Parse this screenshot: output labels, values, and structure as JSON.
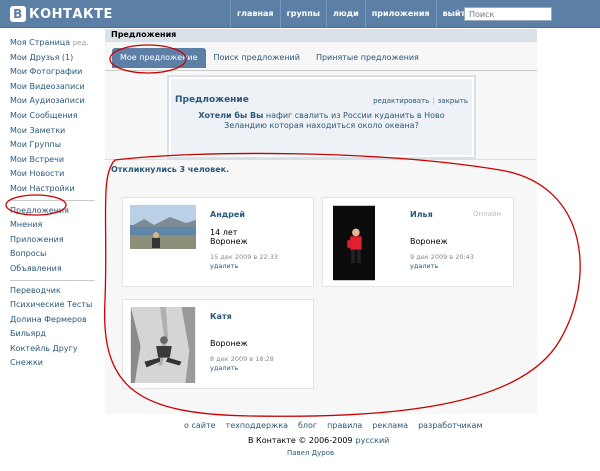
{
  "header": {
    "logo_letter": "В",
    "logo_text": "КОНТАКТЕ",
    "nav": [
      "главная",
      "группы",
      "люди",
      "приложения",
      "выйти"
    ],
    "search_placeholder": "Поиск"
  },
  "sidebar": {
    "group1": [
      {
        "label": "Моя Страница",
        "extra": "ред."
      },
      {
        "label": "Мои Друзья (1)"
      },
      {
        "label": "Мои Фотографии"
      },
      {
        "label": "Мои Видеозаписи"
      },
      {
        "label": "Мои Аудиозаписи"
      },
      {
        "label": "Мои Сообщения"
      },
      {
        "label": "Мои Заметки"
      },
      {
        "label": "Мои Группы"
      },
      {
        "label": "Мои Встречи"
      },
      {
        "label": "Мои Новости"
      },
      {
        "label": "Мои Настройки"
      }
    ],
    "group2": [
      "Предложения",
      "Мнения",
      "Приложения",
      "Вопросы",
      "Объявления"
    ],
    "group3": [
      "Переводчик",
      "Психические Тесты",
      "Долина Фермеров",
      "Бильярд",
      "Коктейль Другу",
      "Снежки"
    ]
  },
  "main": {
    "title": "Предложения",
    "tabs": [
      "Мое предложение",
      "Поиск предложений",
      "Принятые предложения"
    ],
    "proposal": {
      "heading": "Предложение",
      "edit": "редактировать",
      "close": "закрыть",
      "text_bold": "Хотели бы Вы",
      "text_rest": " нафиг свалить из России куданить в Ново Зеландию которая находиться около океана?"
    },
    "responded": "Откликнулись 3 человек.",
    "cards": [
      {
        "name": "Андрей",
        "age": "14 лет",
        "city": "Воронеж",
        "date": "15 дек 2009 в 22:33",
        "delete": "удалить",
        "status": ""
      },
      {
        "name": "Илья",
        "age": "",
        "city": "Воронеж",
        "date": "9 дек 2009 в 20:43",
        "delete": "удалить",
        "status": "Онлайн"
      },
      {
        "name": "Катя",
        "age": "",
        "city": "Воронеж",
        "date": "8 дек 2009 в 18:28",
        "delete": "удалить",
        "status": ""
      }
    ]
  },
  "footer": {
    "links": [
      "о сайте",
      "техподдержка",
      "блог",
      "правила",
      "реклама",
      "разработчикам"
    ],
    "copyright": "В Контакте © 2006-2009",
    "language": "русский",
    "author": "Павел Дуров"
  },
  "colors": {
    "header": "#5c7fa6",
    "link": "#2b587a",
    "annotation": "#cc0000"
  }
}
